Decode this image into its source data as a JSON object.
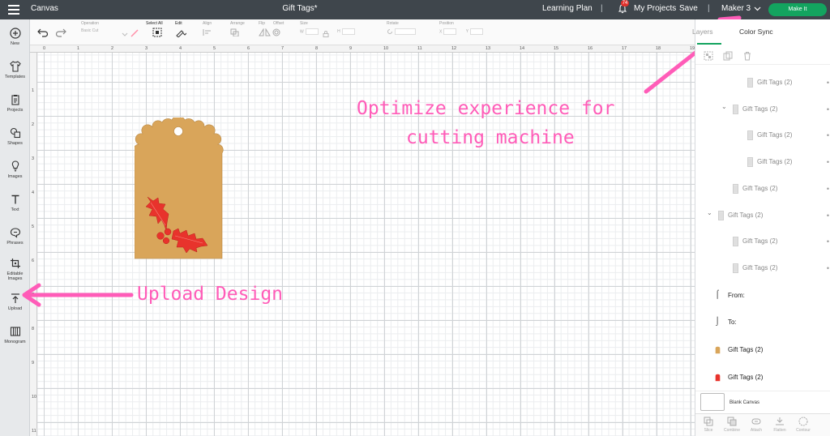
{
  "topbar": {
    "app_title": "Canvas",
    "doc_title": "Gift Tags*",
    "learning_plan": "Learning Plan",
    "separator": "|",
    "notification_count": "74",
    "my_projects": "My Projects",
    "save": "Save",
    "machine": "Maker 3",
    "make_it": "Make It"
  },
  "leftnav": {
    "items": [
      {
        "label": "New",
        "icon": "plus-circle-icon"
      },
      {
        "label": "Templates",
        "icon": "shirt-icon"
      },
      {
        "label": "Projects",
        "icon": "clipboard-icon"
      },
      {
        "label": "Shapes",
        "icon": "shapes-icon"
      },
      {
        "label": "Images",
        "icon": "bulb-icon"
      },
      {
        "label": "Text",
        "icon": "text-icon"
      },
      {
        "label": "Phrases",
        "icon": "speech-bubble-icon"
      },
      {
        "label": "Editable Images",
        "icon": "crop-icon"
      },
      {
        "label": "Upload",
        "icon": "upload-icon"
      },
      {
        "label": "Monogram",
        "icon": "monogram-icon"
      }
    ]
  },
  "toolbar": {
    "operation_label": "Operation",
    "operation_value": "Basic Cut",
    "select_all": "Select All",
    "edit": "Edit",
    "align": "Align",
    "arrange": "Arrange",
    "flip": "Flip",
    "offset": "Offset",
    "size": "Size",
    "size_w": "W",
    "size_h": "H",
    "rotate": "Rotate",
    "position": "Position",
    "pos_x": "X",
    "pos_y": "Y"
  },
  "rulers": {
    "top": [
      "0",
      "1",
      "2",
      "3",
      "4",
      "5",
      "6",
      "7",
      "8",
      "9",
      "10",
      "11",
      "12",
      "13",
      "14",
      "15",
      "16",
      "17",
      "18",
      "19"
    ],
    "left": [
      "1",
      "2",
      "3",
      "4",
      "5",
      "6",
      "7",
      "8",
      "9",
      "10",
      "11"
    ]
  },
  "annotations": {
    "optimize_line1": "Optimize experience for",
    "optimize_line2": "cutting machine",
    "upload": "Upload Design"
  },
  "annotation_color": "#ff5cb8",
  "accent_color": "#13a45f",
  "tag_color": "#d9a55a",
  "holly_color": "#e8332c",
  "rpanel": {
    "tab_layers": "Layers",
    "tab_color_sync": "Color Sync",
    "layers": [
      {
        "name": "Gift Tags (2)",
        "depth": 3,
        "expanded": false
      },
      {
        "name": "Gift Tags (2)",
        "depth": 2,
        "expanded": true
      },
      {
        "name": "Gift Tags (2)",
        "depth": 3,
        "expanded": false
      },
      {
        "name": "Gift Tags (2)",
        "depth": 3,
        "expanded": false
      },
      {
        "name": "Gift Tags (2)",
        "depth": 2,
        "expanded": false
      },
      {
        "name": "Gift Tags (2)",
        "depth": 1,
        "expanded": true
      },
      {
        "name": "Gift Tags (2)",
        "depth": 2,
        "expanded": false
      },
      {
        "name": "Gift Tags (2)",
        "depth": 2,
        "expanded": false
      }
    ],
    "from_label": "From:",
    "to_label": "To:",
    "color_layers": [
      {
        "name": "Gift Tags (2)",
        "color": "#d9a55a"
      },
      {
        "name": "Gift Tags (2)",
        "color": "#e8332c"
      }
    ],
    "blank_canvas": "Blank Canvas",
    "bottom_actions": [
      "Slice",
      "Combine",
      "Attach",
      "Flatten",
      "Contour"
    ]
  }
}
